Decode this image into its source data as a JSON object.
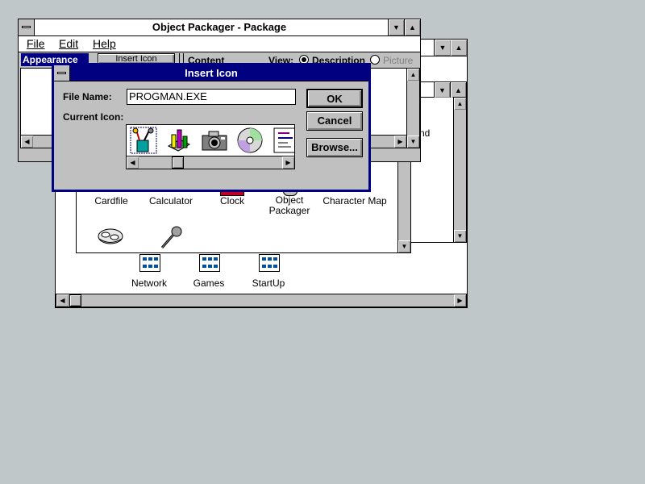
{
  "package_window": {
    "title": "Object Packager - Package",
    "menu": [
      "File",
      "Edit",
      "Help"
    ],
    "appearance_label": "Appearance",
    "insert_icon_button": "Insert Icon",
    "content_label": "Content",
    "view_label": "View:",
    "view_options": [
      {
        "label": "Description",
        "selected": true
      },
      {
        "label": "Picture",
        "selected": false
      }
    ]
  },
  "accessories_window": {
    "icons": [
      {
        "label": "Cardfile",
        "icon": "cardfile-icon"
      },
      {
        "label": "Calculator",
        "icon": "calculator-icon"
      },
      {
        "label": "Clock",
        "icon": "clock-icon"
      },
      {
        "label": "Object Packager",
        "icon": "object-packager-icon"
      },
      {
        "label": "Character Map",
        "icon": "character-map-icon"
      },
      {
        "label": "",
        "icon": "media-player-icon"
      },
      {
        "label": "",
        "icon": "sound-recorder-icon"
      }
    ]
  },
  "program_manager": {
    "partial_label": "nd",
    "groups": [
      {
        "label": "Network",
        "icon": "program-group-icon"
      },
      {
        "label": "Games",
        "icon": "program-group-icon"
      },
      {
        "label": "StartUp",
        "icon": "program-group-icon"
      }
    ]
  },
  "insert_icon_dialog": {
    "title": "Insert Icon",
    "file_name_label": "File Name:",
    "file_name_value": "PROGMAN.EXE",
    "current_icon_label": "Current Icon:",
    "ok_button": "OK",
    "cancel_button": "Cancel",
    "browse_button": "Browse...",
    "icons": [
      "tools-icon",
      "charts-icon",
      "camera-icon",
      "cd-icon",
      "document-icon"
    ],
    "selected_icon": "tools-icon"
  },
  "colors": {
    "desktop": "#c0c7c8",
    "active_title": "#000080",
    "selection": "#0000a8"
  }
}
